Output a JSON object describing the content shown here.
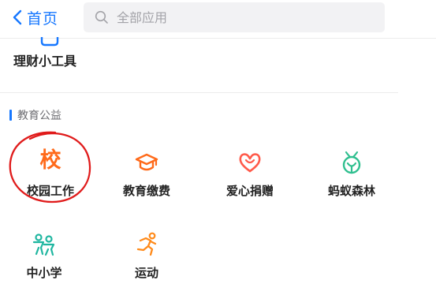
{
  "header": {
    "back_label": "首页",
    "search_placeholder": "全部应用"
  },
  "previous_section": {
    "last_app_label": "理财小工具"
  },
  "section": {
    "title": "教育公益",
    "apps": [
      {
        "label": "校园工作",
        "icon": "school-char-icon",
        "glyph": "校",
        "color": "#ff6a1a",
        "circled": true
      },
      {
        "label": "教育缴费",
        "icon": "graduation-cap-icon",
        "color": "#ff6a1a"
      },
      {
        "label": "爱心捐赠",
        "icon": "heart-icon",
        "color": "#ff5a4a"
      },
      {
        "label": "蚂蚁森林",
        "icon": "sprout-icon",
        "color": "#2fbf8f"
      },
      {
        "label": "中小学",
        "icon": "kids-icon",
        "color": "#1fb6a0"
      },
      {
        "label": "运动",
        "icon": "running-icon",
        "color": "#ff8a1a"
      }
    ]
  },
  "colors": {
    "accent": "#1677ff",
    "annotation_circle": "#e01b1b"
  }
}
